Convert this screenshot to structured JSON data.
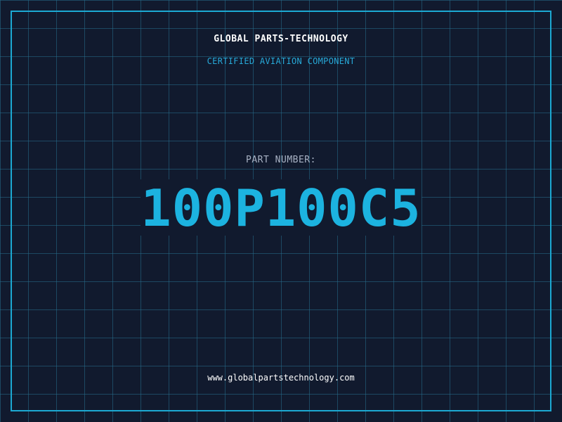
{
  "brand": {
    "company_name": "GLOBAL PARTS-TECHNOLOGY",
    "tagline": "CERTIFIED AVIATION COMPONENT"
  },
  "part": {
    "label": "PART NUMBER:",
    "number": "100P100C5"
  },
  "footer": {
    "website": "www.globalpartstechnology.com"
  },
  "colors": {
    "background": "#111a2e",
    "grid": "#266e8c",
    "frame": "#1ca9d3",
    "accent": "#1cb3e0",
    "text_primary": "#ffffff",
    "text_muted": "#a8b2c4"
  }
}
